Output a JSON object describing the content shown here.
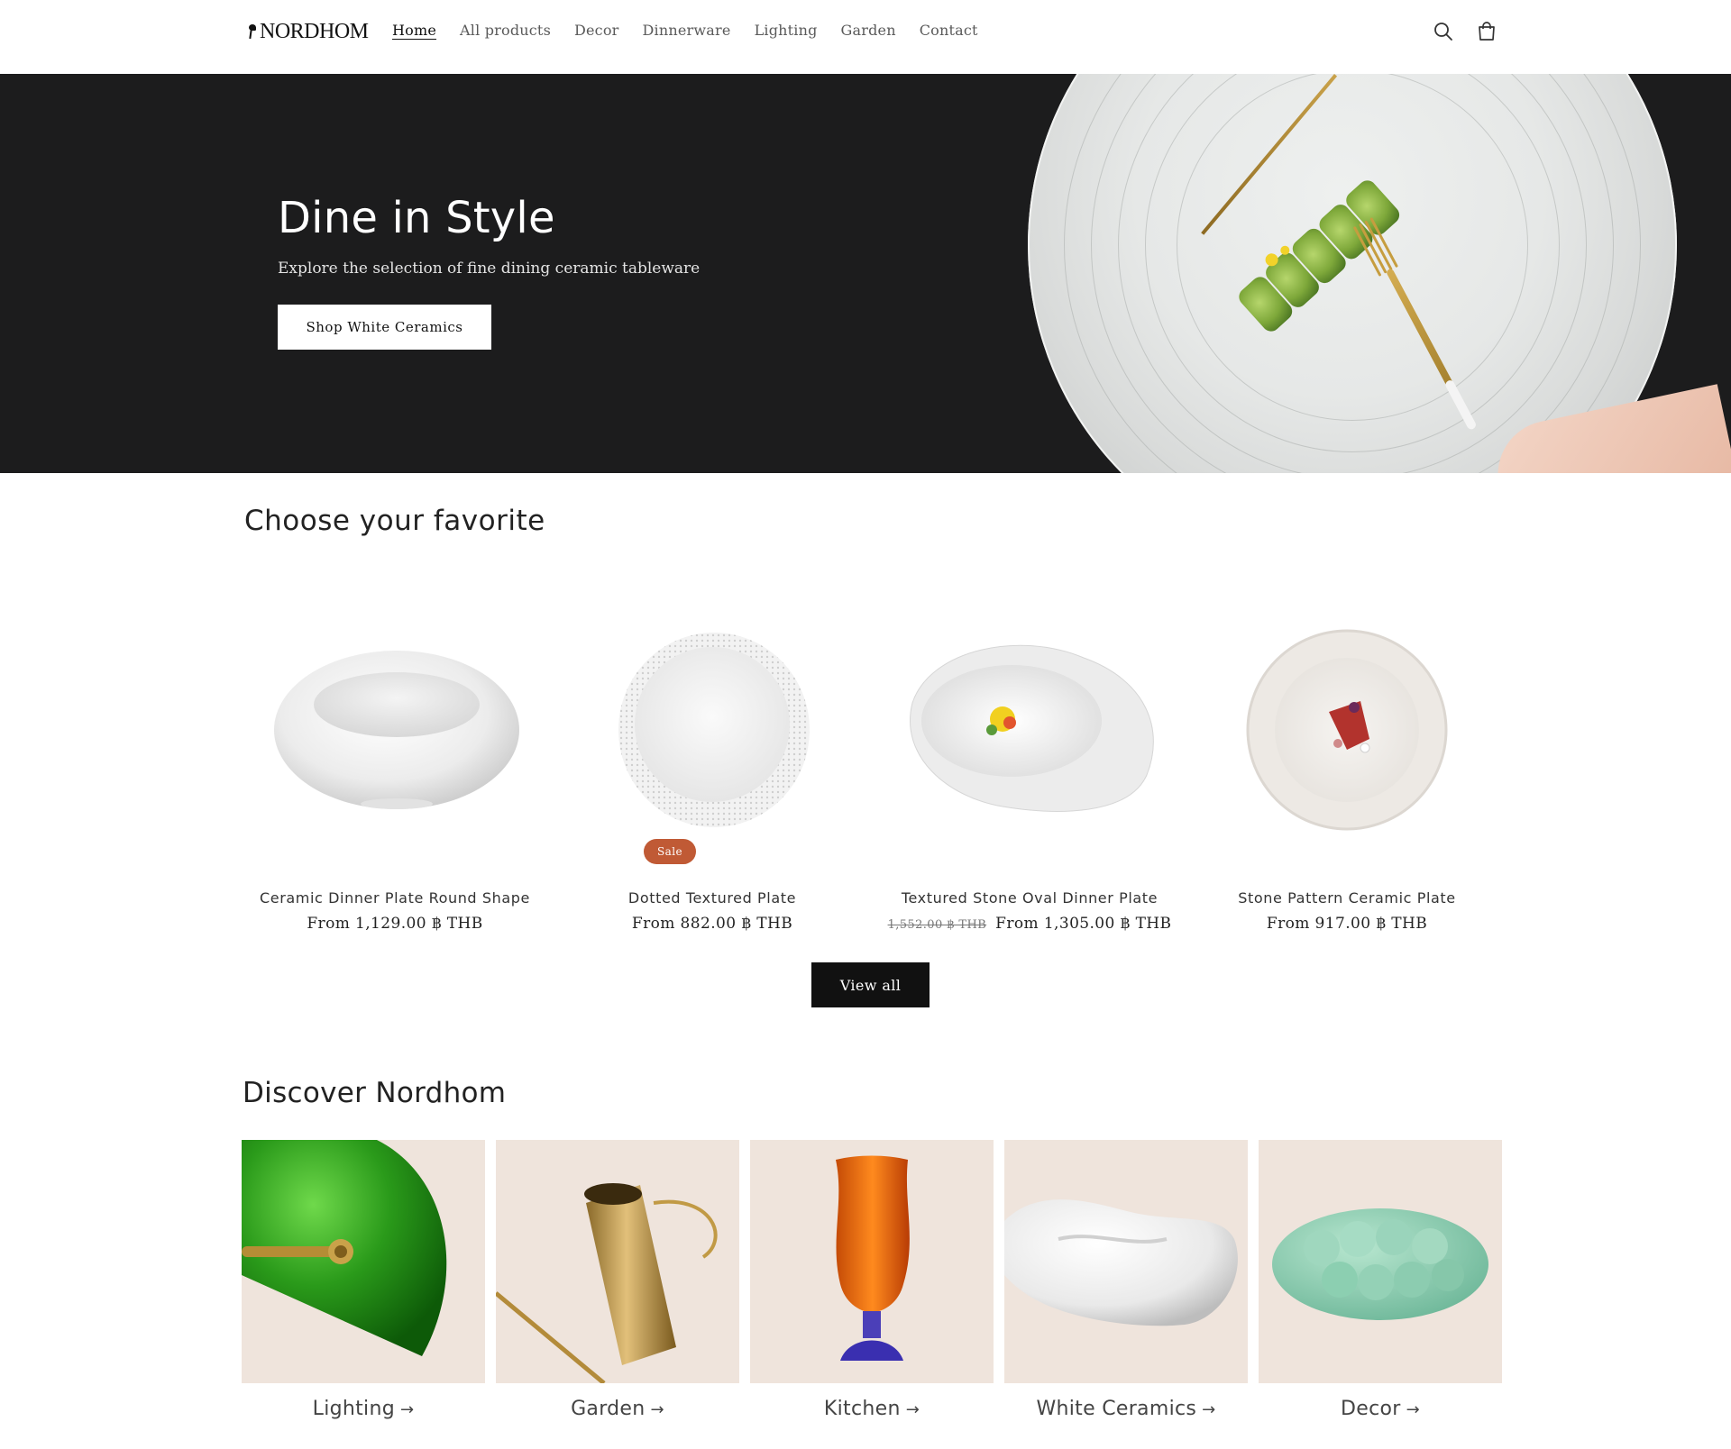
{
  "header": {
    "logo_text": "NORDHOM",
    "nav": [
      {
        "label": "Home",
        "active": true
      },
      {
        "label": "All products",
        "active": false
      },
      {
        "label": "Decor",
        "active": false
      },
      {
        "label": "Dinnerware",
        "active": false
      },
      {
        "label": "Lighting",
        "active": false
      },
      {
        "label": "Garden",
        "active": false
      },
      {
        "label": "Contact",
        "active": false
      }
    ],
    "icons": [
      "search-icon",
      "cart-icon"
    ]
  },
  "hero": {
    "title": "Dine in Style",
    "subtitle": "Explore the selection of fine dining ceramic tableware",
    "button": "Shop White Ceramics",
    "background": "#1c1c1d"
  },
  "featured": {
    "title": "Choose your favorite",
    "products": [
      {
        "name": "Ceramic Dinner Plate Round Shape",
        "price": "From 1,129.00 ฿ THB",
        "old_price": "",
        "sale": false
      },
      {
        "name": "Dotted Textured Plate",
        "price": "From 882.00 ฿ THB",
        "old_price": "",
        "sale": false
      },
      {
        "name": "Textured Stone Oval Dinner Plate",
        "price": "From 1,305.00 ฿ THB",
        "old_price": "1,552.00 ฿ THB",
        "sale": true
      },
      {
        "name": "Stone Pattern Ceramic Plate",
        "price": "From 917.00 ฿ THB",
        "old_price": "",
        "sale": false
      }
    ],
    "sale_badge": "Sale",
    "view_all": "View all",
    "sale_color": "#c05a35"
  },
  "discover": {
    "title": "Discover Nordhom",
    "categories": [
      {
        "label": "Lighting",
        "arrow": "→"
      },
      {
        "label": "Garden",
        "arrow": "→"
      },
      {
        "label": "Kitchen",
        "arrow": "→"
      },
      {
        "label": "White Ceramics",
        "arrow": "→"
      },
      {
        "label": "Decor",
        "arrow": "→"
      }
    ],
    "tile_color": "#efe4dc"
  }
}
